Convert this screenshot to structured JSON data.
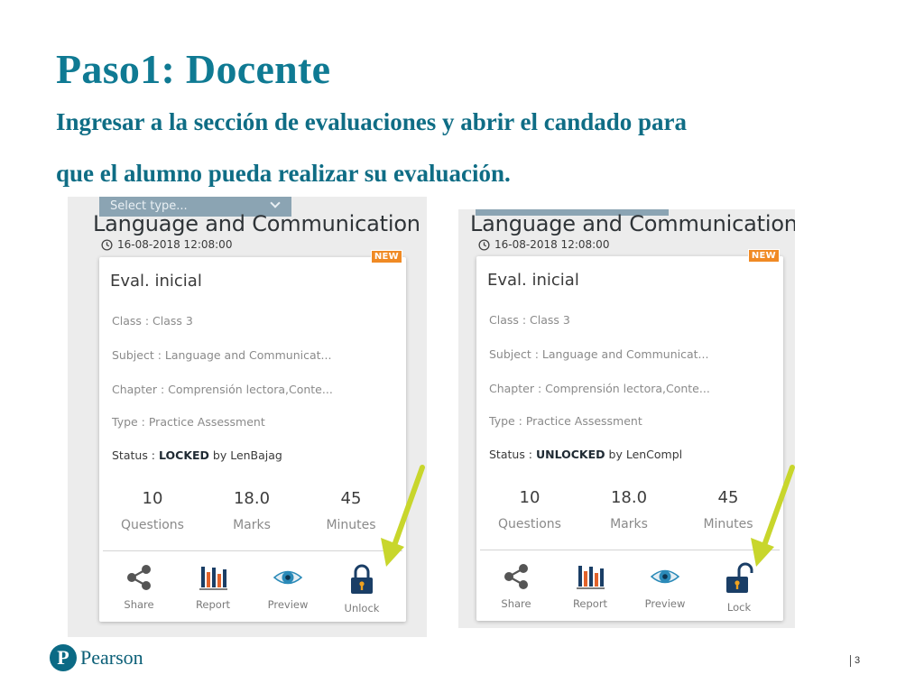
{
  "slide": {
    "title": "Paso1: Docente",
    "subtitle_line1": "Ingresar a la sección de evaluaciones y abrir el candado para",
    "subtitle_line2": "que el alumno pueda realizar su evaluación.",
    "page_number": "3",
    "logo_text": "Pearson",
    "logo_mark": "P"
  },
  "colors": {
    "title": "#0f7a93",
    "badge": "#f08a24",
    "arrow": "#c8d62c",
    "lock_body": "#1a3e66",
    "lock_keyhole": "#f0a21f",
    "eye": "#2a8ab8"
  },
  "panels": [
    {
      "select_placeholder": "Select type...",
      "course_title": "Language and Communication",
      "datetime": "16-08-2018 12:08:00",
      "badge": "NEW",
      "eval_name": "Eval. inicial",
      "class_line": "Class : Class 3",
      "subject_line": "Subject : Language and Communicat...",
      "chapter_line": "Chapter : Comprensión lectora,Conte...",
      "type_line": "Type : Practice Assessment",
      "status_prefix": "Status : ",
      "status_value": "LOCKED",
      "status_suffix": " by LenBajag",
      "stats": [
        {
          "value": "10",
          "label": "Questions"
        },
        {
          "value": "18.0",
          "label": "Marks"
        },
        {
          "value": "45",
          "label": "Minutes"
        }
      ],
      "actions": [
        {
          "label": "Share",
          "icon": "share-icon"
        },
        {
          "label": "Report",
          "icon": "report-icon"
        },
        {
          "label": "Preview",
          "icon": "eye-icon"
        },
        {
          "label": "Unlock",
          "icon": "lock-closed-icon"
        }
      ]
    },
    {
      "course_title": "Language and Communication",
      "datetime": "16-08-2018 12:08:00",
      "badge": "NEW",
      "eval_name": "Eval. inicial",
      "class_line": "Class : Class 3",
      "subject_line": "Subject : Language and Communicat...",
      "chapter_line": "Chapter : Comprensión lectora,Conte...",
      "type_line": "Type : Practice Assessment",
      "status_prefix": "Status : ",
      "status_value": "UNLOCKED",
      "status_suffix": " by LenCompl",
      "stats": [
        {
          "value": "10",
          "label": "Questions"
        },
        {
          "value": "18.0",
          "label": "Marks"
        },
        {
          "value": "45",
          "label": "Minutes"
        }
      ],
      "actions": [
        {
          "label": "Share",
          "icon": "share-icon"
        },
        {
          "label": "Report",
          "icon": "report-icon"
        },
        {
          "label": "Preview",
          "icon": "eye-icon"
        },
        {
          "label": "Lock",
          "icon": "lock-open-icon"
        }
      ]
    }
  ]
}
